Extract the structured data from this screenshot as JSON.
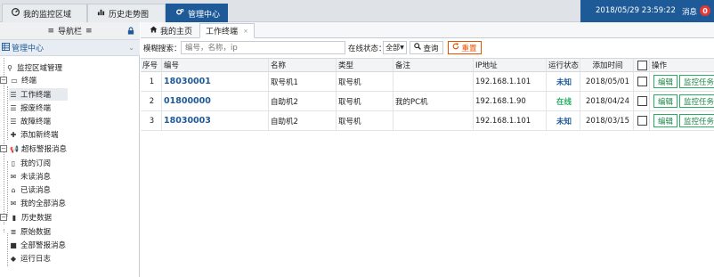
{
  "top_tabs": [
    {
      "label": "我的监控区域",
      "icon": "dashboard-icon"
    },
    {
      "label": "历史走势图",
      "icon": "bar-chart-icon"
    },
    {
      "label": "管理中心",
      "icon": "gear-icon"
    }
  ],
  "header": {
    "datetime": "2018/05/29 23:59:22",
    "message_label": "消息",
    "message_count": "0"
  },
  "sidebar": {
    "title": "导航栏",
    "menu_title": "管理中心",
    "tree": [
      {
        "label": "监控区域管理",
        "icon": "map-pin-icon"
      },
      {
        "label": "终端",
        "icon": "monitor-icon"
      },
      {
        "label": "工作终端",
        "icon": "list-icon"
      },
      {
        "label": "报废终端",
        "icon": "list-icon"
      },
      {
        "label": "故障终端",
        "icon": "list-icon"
      },
      {
        "label": "添加新终端",
        "icon": "plus-icon"
      },
      {
        "label": "超标警报消息",
        "icon": "bullhorn-icon"
      },
      {
        "label": "我的订阅",
        "icon": "bookmark-icon"
      },
      {
        "label": "未读消息",
        "icon": "envelope-icon"
      },
      {
        "label": "已读消息",
        "icon": "envelope-open-icon"
      },
      {
        "label": "我的全部消息",
        "icon": "envelope-solid-icon"
      },
      {
        "label": "历史数据",
        "icon": "book-icon"
      },
      {
        "label": "原始数据",
        "icon": "database-icon"
      },
      {
        "label": "全部警报消息",
        "icon": "folder-icon"
      },
      {
        "label": "运行日志",
        "icon": "tag-icon"
      }
    ]
  },
  "tabs": {
    "home": "我的主页",
    "work": "工作终端"
  },
  "filters": {
    "fuzzy_label": "模糊搜索：",
    "search_placeholder": "编号，名称，ip",
    "online_label": "在线状态：",
    "online_value": "全部",
    "query_button": "查询",
    "reset_button": "重置"
  },
  "table": {
    "headers": [
      "序号",
      "编号",
      "名称",
      "类型",
      "备注",
      "IP地址",
      "运行状态",
      "添加时间",
      "",
      "操作"
    ],
    "rows": [
      {
        "index": "1",
        "code": "18030001",
        "name": "取号机1",
        "type": "取号机",
        "remark": "",
        "ip": "192.168.1.101",
        "status": "未知",
        "date": "2018/05/01"
      },
      {
        "index": "2",
        "code": "01800000",
        "name": "自助机2",
        "type": "取号机",
        "remark": "我的PC机",
        "ip": "192.168.1.90",
        "status": "在线",
        "date": "2018/04/24"
      },
      {
        "index": "3",
        "code": "18030003",
        "name": "自助机2",
        "type": "取号机",
        "remark": "",
        "ip": "192.168.1.101",
        "status": "未知",
        "date": "2018/03/15"
      }
    ],
    "edit_button": "编辑",
    "task_button": "监控任务"
  },
  "colors": {
    "brand": "#1f5a98",
    "online": "#27ae60",
    "reset": "#e65100",
    "badge": "#e53935"
  }
}
